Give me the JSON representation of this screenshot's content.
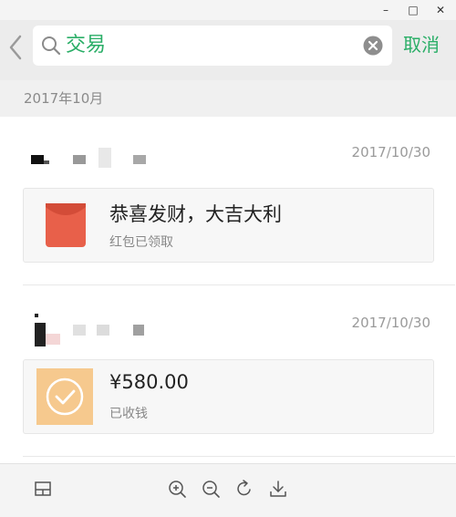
{
  "window": {
    "minimize_glyph": "–",
    "maximize_glyph": "□",
    "close_glyph": "✕"
  },
  "search": {
    "query": "交易",
    "cancel_label": "取消"
  },
  "list": {
    "month_header": "2017年10月",
    "items": [
      {
        "date": "2017/10/30",
        "title": "恭喜发财，大吉大利",
        "subtitle": "红包已领取",
        "icon": "red-packet-icon"
      },
      {
        "date": "2017/10/30",
        "title": "¥580.00",
        "subtitle": "已收钱",
        "icon": "transfer-received-icon"
      }
    ]
  },
  "toolbar": {
    "icons": [
      "layout-icon",
      "zoom-in-icon",
      "zoom-out-icon",
      "rotate-icon",
      "download-icon"
    ]
  },
  "colors": {
    "accent_green": "#2aae67",
    "red_packet": "#e8604a",
    "transfer_orange": "#f6c98e"
  }
}
